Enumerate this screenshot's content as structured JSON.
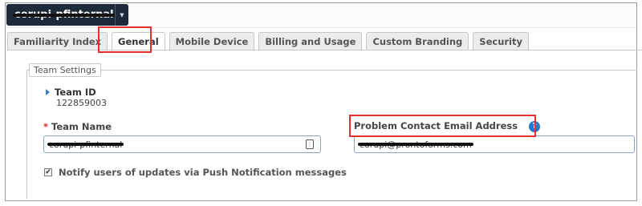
{
  "header": {
    "team_switcher": {
      "name": "corupi-pfinternal",
      "caret": "▼"
    }
  },
  "tabs": [
    {
      "label": "Familiarity Index",
      "active": false
    },
    {
      "label": "General",
      "active": true
    },
    {
      "label": "Mobile Device",
      "active": false
    },
    {
      "label": "Billing and Usage",
      "active": false
    },
    {
      "label": "Custom Branding",
      "active": false
    },
    {
      "label": "Security",
      "active": false
    }
  ],
  "team_settings": {
    "legend": "Team Settings",
    "team_id": {
      "label": "Team ID",
      "value": "122859003"
    },
    "team_name": {
      "required_marker": "*",
      "label": "Team Name",
      "value": "corupi-pfinternal"
    },
    "problem_contact": {
      "label": "Problem Contact Email Address",
      "value": "corupi@prontoforms.com",
      "help_icon": "?"
    },
    "push_notification": {
      "checked": true,
      "label": "Notify users of updates via Push Notification messages"
    }
  },
  "colors": {
    "accent_blue": "#1e7ad3",
    "highlight_red": "#e53030",
    "required_red": "#d9342b",
    "switcher_bg": "#1d2a3a"
  }
}
